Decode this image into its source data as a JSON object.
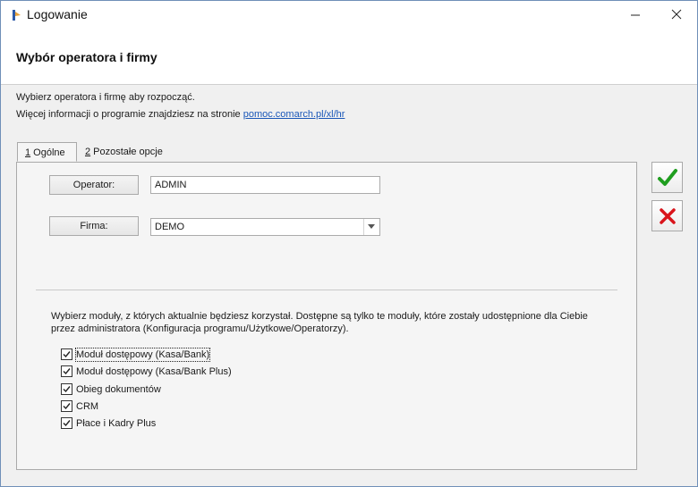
{
  "window": {
    "title": "Logowanie",
    "minimize_icon": "minimize-icon",
    "close_icon": "close-icon"
  },
  "header": {
    "title": "Wybór operatora i firmy"
  },
  "info": {
    "line1": "Wybierz operatora i firmę aby rozpocząć.",
    "line2_prefix": "Więcej informacji o programie znajdziesz na stronie ",
    "link": "pomoc.comarch.pl/xl/hr"
  },
  "tabs": [
    {
      "key": "1",
      "label": " Ogólne",
      "active": true
    },
    {
      "key": "2",
      "label": " Pozostałe opcje",
      "active": false
    }
  ],
  "operator": {
    "label": "Operator:",
    "value": "ADMIN"
  },
  "firma": {
    "label": "Firma:",
    "value": "DEMO"
  },
  "modules": {
    "hint": "Wybierz moduły, z których aktualnie będziesz korzystał. Dostępne są tylko te moduły, które zostały udostępnione dla Ciebie przez administratora (Konfiguracja programu/Użytkowe/Operatorzy).",
    "items": [
      {
        "label": "Moduł dostępowy (Kasa/Bank)",
        "checked": true
      },
      {
        "label": "Moduł dostępowy (Kasa/Bank Plus)",
        "checked": true
      },
      {
        "label": "Obieg dokumentów",
        "checked": true
      },
      {
        "label": "CRM",
        "checked": true
      },
      {
        "label": "Płace i Kadry Plus",
        "checked": true
      }
    ]
  },
  "actions": {
    "ok_icon": "checkmark-icon",
    "cancel_icon": "cross-icon",
    "ok_color": "#1f9e1f",
    "cancel_color": "#d9141b"
  }
}
